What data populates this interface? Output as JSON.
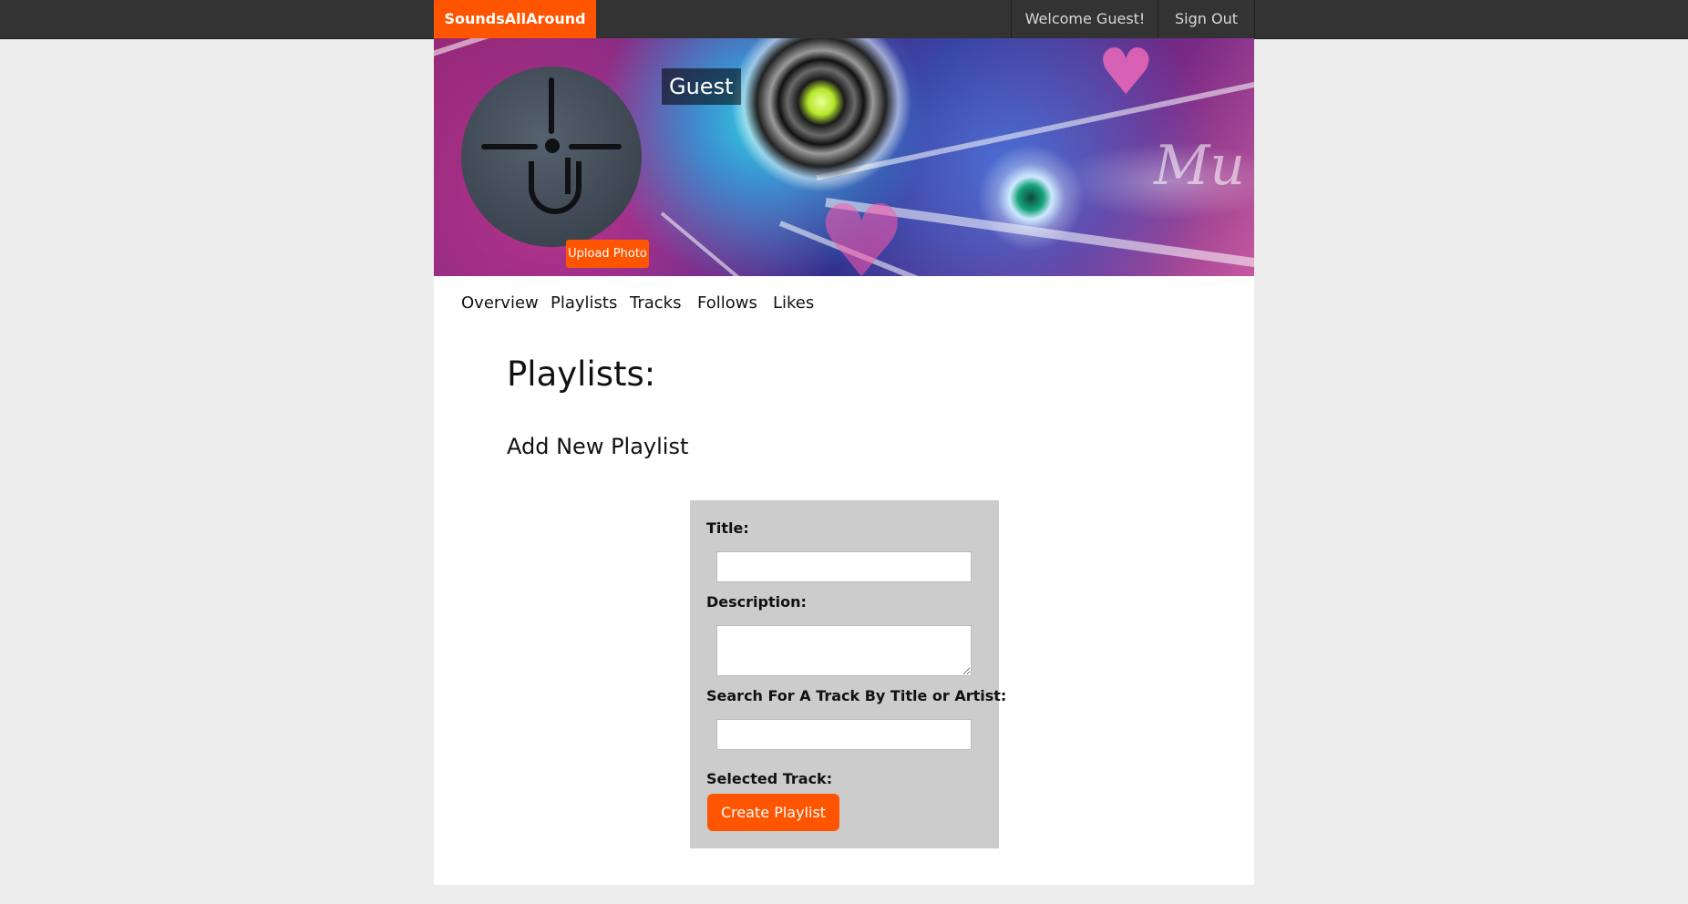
{
  "topbar": {
    "brand": "SoundsAllAround",
    "welcome": "Welcome Guest!",
    "sign_out": "Sign Out",
    "brand_color": "#ff5500",
    "bar_color": "#333333"
  },
  "profile": {
    "user_name": "Guest",
    "upload_photo": "Upload Photo",
    "avatar_icon": "anchor-cross-icon"
  },
  "tabs": [
    "Overview",
    "Playlists",
    "Tracks",
    "Follows",
    "Likes"
  ],
  "main": {
    "heading": "Playlists:",
    "subheading": "Add New Playlist"
  },
  "form": {
    "title_label": "Title:",
    "title_value": "",
    "description_label": "Description:",
    "description_value": "",
    "search_label": "Search For A Track By Title or Artist:",
    "search_value": "",
    "selected_label": "Selected Track:",
    "create_button": "Create Playlist"
  }
}
